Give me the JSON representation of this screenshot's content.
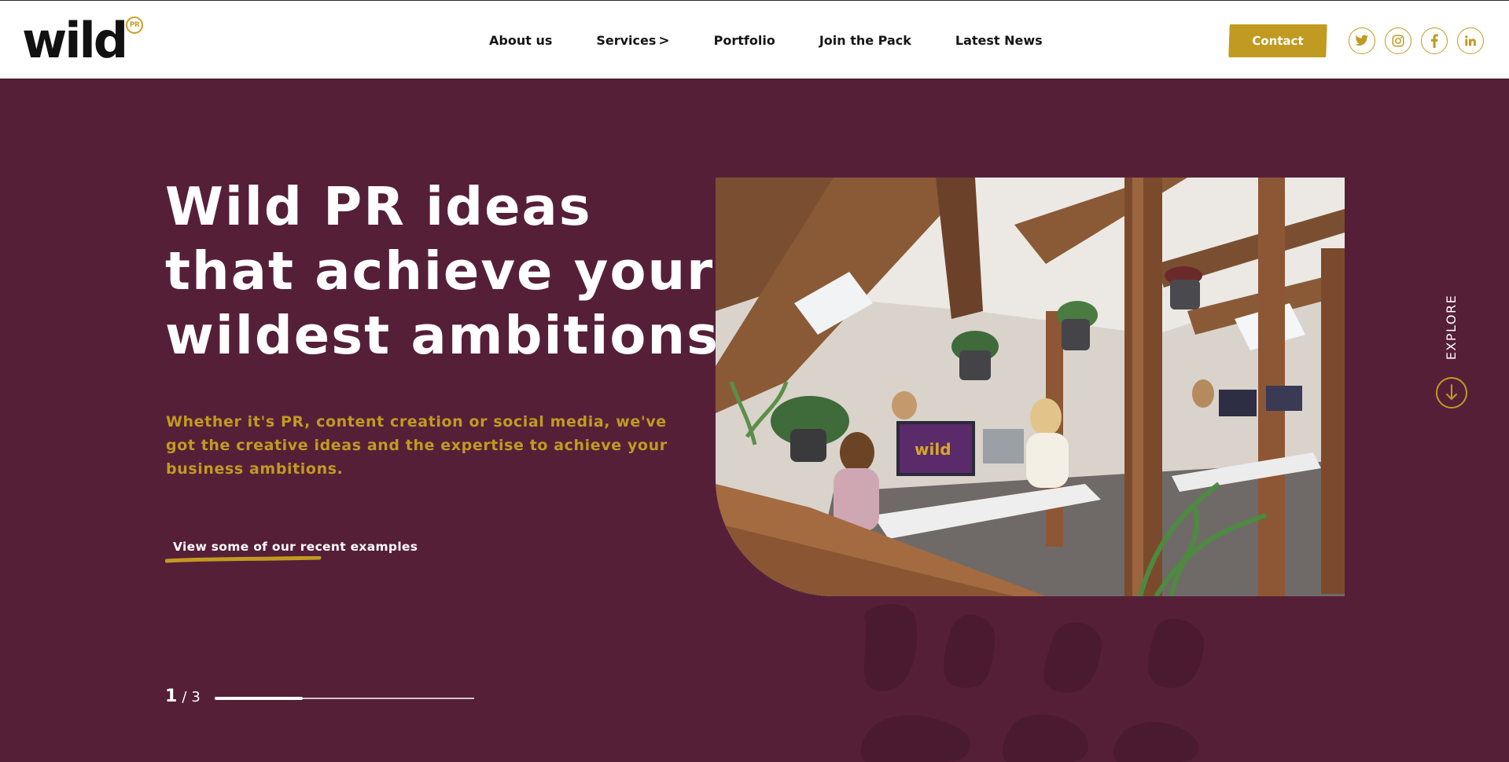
{
  "header": {
    "logo_text": "wild",
    "logo_badge": "PR",
    "nav": [
      {
        "label": "About us"
      },
      {
        "label": "Services",
        "chevron": ">"
      },
      {
        "label": "Portfolio"
      },
      {
        "label": "Join the Pack"
      },
      {
        "label": "Latest News"
      }
    ],
    "contact_label": "Contact",
    "social": [
      "twitter-icon",
      "instagram-icon",
      "facebook-icon",
      "linkedin-icon"
    ]
  },
  "hero": {
    "title_lines": [
      "Wild PR ideas",
      "that achieve your",
      "wildest ambitions!"
    ],
    "subtitle": "Whether it's PR, content creation or social media, we've got the creative ideas and the expertise to achieve your business ambitions.",
    "cta_label": "View some of our recent examples",
    "photo_sign": "wild"
  },
  "explore": {
    "label": "EXPLORE"
  },
  "pager": {
    "current": "1",
    "separator": "/",
    "total": "3",
    "progress": 0.34
  },
  "colors": {
    "brand_purple": "#561f38",
    "gold": "#c19a21",
    "white": "#ffffff"
  }
}
